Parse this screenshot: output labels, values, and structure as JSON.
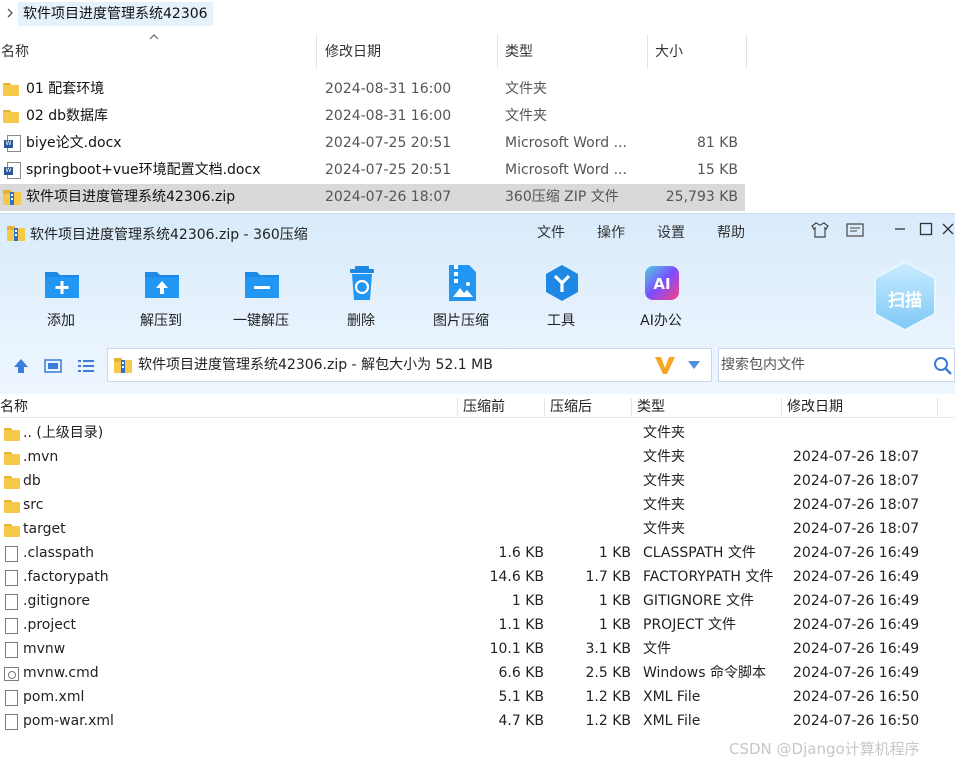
{
  "explorer": {
    "breadcrumb": "软件项目进度管理系统42306",
    "columns": {
      "name": "名称",
      "date": "修改日期",
      "type": "类型",
      "size": "大小"
    },
    "rows": [
      {
        "name": "01 配套环境",
        "date": "2024-08-31 16:00",
        "type": "文件夹",
        "size": "",
        "icon": "folder-icon"
      },
      {
        "name": "02 db数据库",
        "date": "2024-08-31 16:00",
        "type": "文件夹",
        "size": "",
        "icon": "folder-icon"
      },
      {
        "name": "biye论文.docx",
        "date": "2024-07-25 20:51",
        "type": "Microsoft Word ...",
        "size": "81 KB",
        "icon": "word-document-icon"
      },
      {
        "name": "springboot+vue环境配置文档.docx",
        "date": "2024-07-25 20:51",
        "type": "Microsoft Word ...",
        "size": "15 KB",
        "icon": "word-document-icon"
      },
      {
        "name": "软件项目进度管理系统42306.zip",
        "date": "2024-07-26 18:07",
        "type": "360压缩 ZIP 文件",
        "size": "25,793 KB",
        "icon": "zip-archive-icon",
        "selected": true
      }
    ]
  },
  "zip_window": {
    "title": "软件项目进度管理系统42306.zip - 360压缩",
    "menu": [
      "文件",
      "操作",
      "设置",
      "帮助"
    ],
    "toolbar": [
      {
        "label": "添加",
        "icon": "add-icon"
      },
      {
        "label": "解压到",
        "icon": "extract-to-icon"
      },
      {
        "label": "一键解压",
        "icon": "one-click-extract-icon"
      },
      {
        "label": "删除",
        "icon": "delete-icon"
      },
      {
        "label": "图片压缩",
        "icon": "image-compress-icon"
      },
      {
        "label": "工具",
        "icon": "tools-icon"
      },
      {
        "label": "AI办公",
        "icon": "ai-office-icon"
      }
    ],
    "scan_label": "扫描",
    "path": "软件项目进度管理系统42306.zip - 解包大小为 52.1 MB",
    "search_placeholder": "搜索包内文件",
    "columns": {
      "name": "名称",
      "compressed": "压缩前",
      "uncompressed": "压缩后",
      "type": "类型",
      "date": "修改日期"
    },
    "rows": [
      {
        "name": ".. (上级目录)",
        "before": "",
        "after": "",
        "type": "文件夹",
        "date": "",
        "icon": "folder-icon"
      },
      {
        "name": ".mvn",
        "before": "",
        "after": "",
        "type": "文件夹",
        "date": "2024-07-26 18:07",
        "icon": "folder-icon"
      },
      {
        "name": "db",
        "before": "",
        "after": "",
        "type": "文件夹",
        "date": "2024-07-26 18:07",
        "icon": "folder-icon"
      },
      {
        "name": "src",
        "before": "",
        "after": "",
        "type": "文件夹",
        "date": "2024-07-26 18:07",
        "icon": "folder-icon"
      },
      {
        "name": "target",
        "before": "",
        "after": "",
        "type": "文件夹",
        "date": "2024-07-26 18:07",
        "icon": "folder-icon"
      },
      {
        "name": ".classpath",
        "before": "1.6 KB",
        "after": "1 KB",
        "type": "CLASSPATH 文件",
        "date": "2024-07-26 16:49",
        "icon": "file-icon"
      },
      {
        "name": ".factorypath",
        "before": "14.6 KB",
        "after": "1.7 KB",
        "type": "FACTORYPATH 文件",
        "date": "2024-07-26 16:49",
        "icon": "file-icon"
      },
      {
        "name": ".gitignore",
        "before": "1 KB",
        "after": "1 KB",
        "type": "GITIGNORE 文件",
        "date": "2024-07-26 16:49",
        "icon": "file-icon"
      },
      {
        "name": ".project",
        "before": "1.1 KB",
        "after": "1 KB",
        "type": "PROJECT 文件",
        "date": "2024-07-26 16:49",
        "icon": "file-icon"
      },
      {
        "name": "mvnw",
        "before": "10.1 KB",
        "after": "3.1 KB",
        "type": "文件",
        "date": "2024-07-26 16:49",
        "icon": "file-icon"
      },
      {
        "name": "mvnw.cmd",
        "before": "6.6 KB",
        "after": "2.5 KB",
        "type": "Windows 命令脚本",
        "date": "2024-07-26 16:49",
        "icon": "cmd-script-icon"
      },
      {
        "name": "pom.xml",
        "before": "5.1 KB",
        "after": "1.2 KB",
        "type": "XML File",
        "date": "2024-07-26 16:50",
        "icon": "file-icon"
      },
      {
        "name": "pom-war.xml",
        "before": "4.7 KB",
        "after": "1.2 KB",
        "type": "XML File",
        "date": "2024-07-26 16:50",
        "icon": "file-icon"
      }
    ]
  },
  "watermark": "CSDN @Django计算机程序",
  "colors": {
    "accent": "#1e88e5",
    "selection": "#d9d9d9",
    "folder": "#f6c94a",
    "banner": "#dcedfb"
  }
}
